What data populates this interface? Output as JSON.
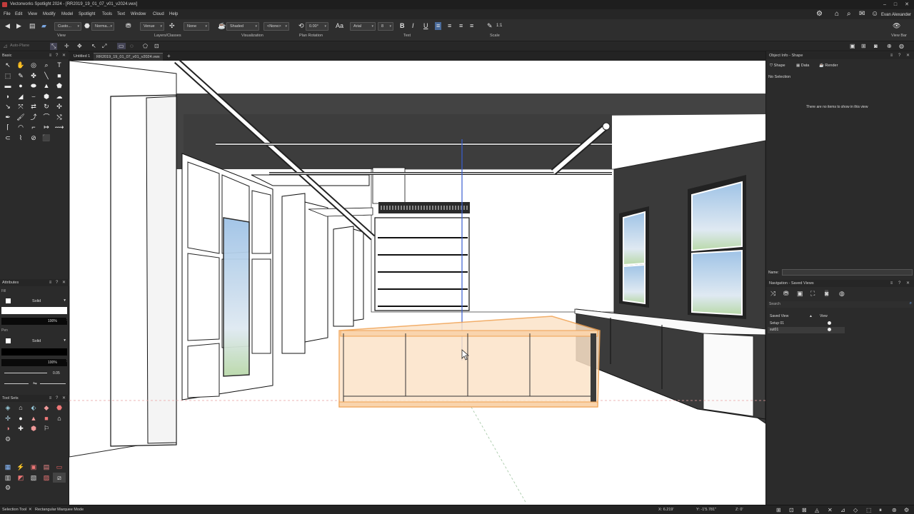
{
  "window": {
    "title": "Vectorworks Spotlight 2024 - [RR2019_19_01_07_v01_v2024.vwx]"
  },
  "menu": [
    "File",
    "Edit",
    "View",
    "Modify",
    "Model",
    "Spotlight",
    "Tools",
    "Text",
    "Window",
    "Cloud",
    "Help"
  ],
  "user": {
    "name": "Evan Alexander"
  },
  "toolbar": {
    "view_label": "View",
    "view_value": "Custo...",
    "render_quality": "Norma...",
    "layers_classes_label": "Layers/Classes",
    "layer_value": "Venue",
    "class_value": "None",
    "visualization_label": "Visualization",
    "render_mode": "Shaded",
    "none_value": "<None>",
    "plan_rotation_label": "Plan Rotation",
    "plan_rotation": "0.00°",
    "text_label": "Text",
    "font": "Arial",
    "font_size": "8",
    "scale_label": "Scale",
    "scale_value": "1:1",
    "viewbar_label": "View Bar"
  },
  "viewbar": {
    "auto_plane": "Auto-Plane"
  },
  "tabs": [
    {
      "label": "Untitled 1",
      "active": false
    },
    {
      "label": "RR2019_19_01_07_v01_v2024.vwx",
      "active": true
    }
  ],
  "palettes": {
    "basic": "Basic",
    "attributes": "Attributes",
    "fill_label": "Fill",
    "fill_style": "Solid",
    "fill_opacity": "100%",
    "pen_label": "Pen",
    "pen_style": "Solid",
    "pen_opacity": "100%",
    "line_weight": "0.05",
    "tool_sets": "Tool Sets"
  },
  "object_info": {
    "title": "Object Info - Shape",
    "tabs": [
      "Shape",
      "Data",
      "Render"
    ],
    "selection": "No Selection",
    "empty_message": "There are no items to show in this view",
    "name_label": "Name:"
  },
  "navigation": {
    "title": "Navigation - Saved Views",
    "search_placeholder": "Search",
    "col_saved_view": "Saved View",
    "col_view": "View",
    "rows": [
      "Setup 01",
      "sut01"
    ]
  },
  "status": {
    "tool": "Selection Tool",
    "mode": "Rectangular Marquee Mode",
    "x": "X: 6.219'",
    "y": "Y: -1'5.781\"",
    "z": "Z: 0'"
  },
  "colors": {
    "accent": "#f0a050",
    "wall_dark": "#3a3a3a",
    "selection_fill": "#fce3c8"
  }
}
